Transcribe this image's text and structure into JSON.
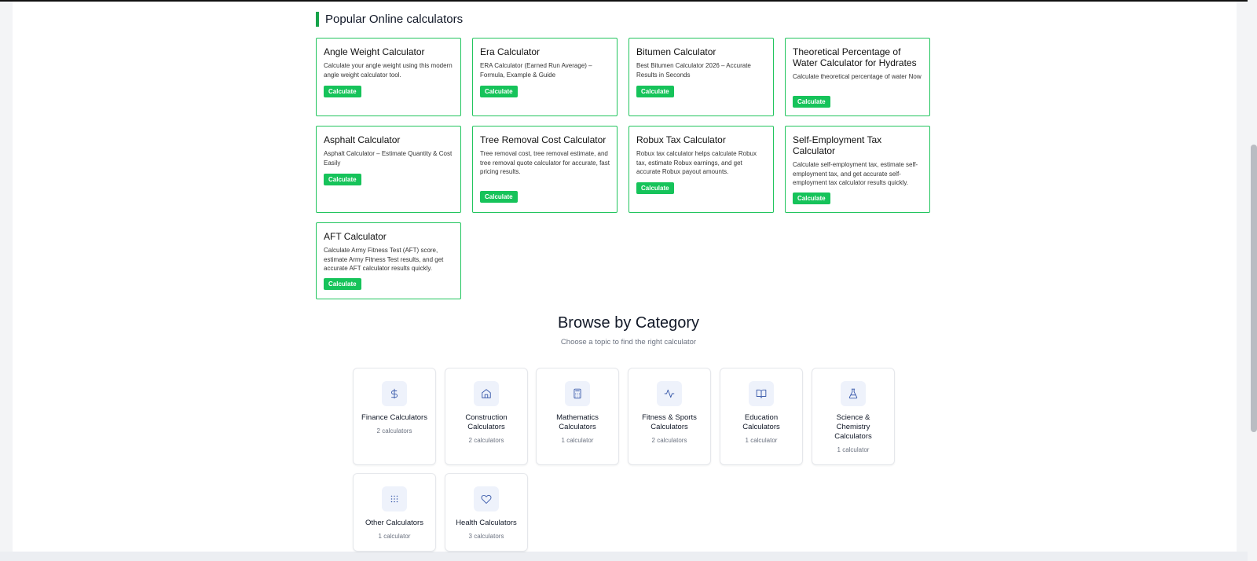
{
  "section": {
    "title": "Popular Online calculators"
  },
  "calculators": [
    {
      "title": "Angle Weight Calculator",
      "desc": "Calculate your angle weight using this modern angle weight calculator tool.",
      "button": "Calculate"
    },
    {
      "title": "Era Calculator",
      "desc": "ERA Calculator (Earned Run Average) – Formula, Example & Guide",
      "button": "Calculate"
    },
    {
      "title": "Bitumen Calculator",
      "desc": "Best Bitumen Calculator 2026 – Accurate Results in Seconds",
      "button": "Calculate"
    },
    {
      "title": "Theoretical Percentage of Water Calculator for Hydrates",
      "desc": "Calculate theoretical percentage of water Now",
      "button": "Calculate"
    },
    {
      "title": "Asphalt Calculator",
      "desc": "Asphalt Calculator – Estimate Quantity & Cost Easily",
      "button": "Calculate"
    },
    {
      "title": "Tree Removal Cost Calculator",
      "desc": "Tree removal cost, tree removal estimate, and tree removal quote calculator for accurate, fast pricing results.",
      "button": "Calculate"
    },
    {
      "title": "Robux Tax Calculator",
      "desc": "Robux tax calculator helps calculate Robux tax, estimate Robux earnings, and get accurate Robux payout amounts.",
      "button": "Calculate"
    },
    {
      "title": "Self-Employment Tax Calculator",
      "desc": "Calculate self-employment tax, estimate self-employment tax, and get accurate self-employment tax calculator results quickly.",
      "button": "Calculate"
    },
    {
      "title": "AFT Calculator",
      "desc": "Calculate Army Fitness Test (AFT) score, estimate Army Fitness Test results, and get accurate AFT calculator results quickly.",
      "button": "Calculate"
    }
  ],
  "browse": {
    "title": "Browse by Category",
    "subtitle": "Choose a topic to find the right calculator",
    "categories": [
      {
        "name": "Finance Calculators",
        "count": "2 calculators",
        "icon": "dollar-icon"
      },
      {
        "name": "Construction Calculators",
        "count": "2 calculators",
        "icon": "home-icon"
      },
      {
        "name": "Mathematics Calculators",
        "count": "1 calculator",
        "icon": "calculator-icon"
      },
      {
        "name": "Fitness & Sports Calculators",
        "count": "2 calculators",
        "icon": "activity-icon"
      },
      {
        "name": "Education Calculators",
        "count": "1 calculator",
        "icon": "book-icon"
      },
      {
        "name": "Science & Chemistry Calculators",
        "count": "1 calculator",
        "icon": "flask-icon"
      },
      {
        "name": "Other Calculators",
        "count": "1 calculator",
        "icon": "grid-icon"
      },
      {
        "name": "Health Calculators",
        "count": "3 calculators",
        "icon": "heart-icon"
      }
    ]
  },
  "colors": {
    "accent": "#16c35a",
    "card_border": "#22c55e",
    "icon_stroke": "#3b5bab",
    "icon_bg": "#eef2fb"
  }
}
